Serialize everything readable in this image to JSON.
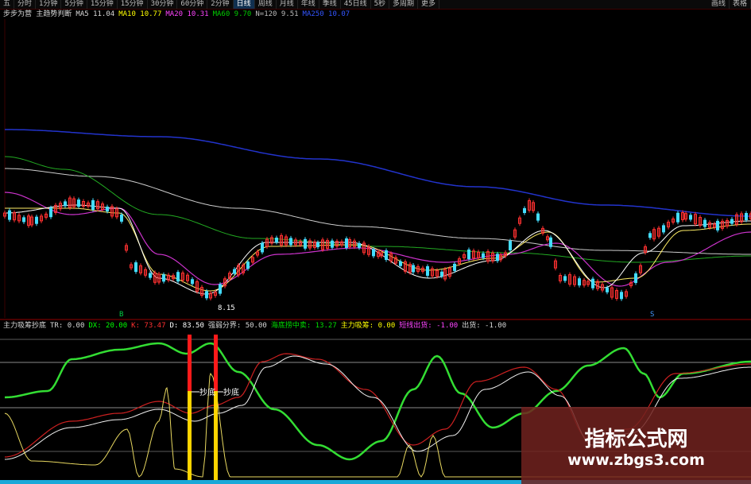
{
  "toolbar": {
    "items": [
      "五",
      "分时",
      "1分钟",
      "5分钟",
      "15分钟",
      "15分钟",
      "30分钟",
      "60分钟",
      "2分钟",
      "日线",
      "周线",
      "月线",
      "年线",
      "季线",
      "45日线",
      "5秒",
      "多周期",
      "更多"
    ],
    "active_index": 9,
    "right_items": [
      "画线",
      "表格"
    ]
  },
  "ma_legend": {
    "title": "步步为营 主趋势判断",
    "items": [
      {
        "label": "MA5 11.04",
        "color": "#d8d8d8"
      },
      {
        "label": "MA10 10.77",
        "color": "#ffff00"
      },
      {
        "label": "MA20 10.31",
        "color": "#ff44ff"
      },
      {
        "label": "MA60 9.70",
        "color": "#00cc00"
      },
      {
        "label": "N=120 9.51",
        "color": "#bbbbbb"
      },
      {
        "label": "MA250 10.07",
        "color": "#3355ff"
      }
    ]
  },
  "indicator_legend": {
    "title": "主力吸筹抄底",
    "items": [
      {
        "label": "TR: 0.00",
        "color": "#d8d8d8"
      },
      {
        "label": "DX: 20.00",
        "color": "#00ff00"
      },
      {
        "label": "K: 73.47",
        "color": "#ff3030"
      },
      {
        "label": "D: 83.50",
        "color": "#ffffff"
      },
      {
        "label": "强弱分界: 50.00",
        "color": "#d8d8d8"
      },
      {
        "label": "海底捞中卖: 13.27",
        "color": "#00dd00"
      },
      {
        "label": "主力吸筹: 0.00",
        "color": "#ffff00"
      },
      {
        "label": "短线出货: -1.00",
        "color": "#ff44ff"
      },
      {
        "label": "出货: -1.00",
        "color": "#d8d8d8"
      }
    ]
  },
  "price_chart": {
    "low_label": "8.15",
    "markers": [
      "B",
      "S"
    ]
  },
  "signals": {
    "buy_label": "抄底"
  },
  "watermark": {
    "title": "指标公式网",
    "url": "www.zbgs3.com"
  }
}
